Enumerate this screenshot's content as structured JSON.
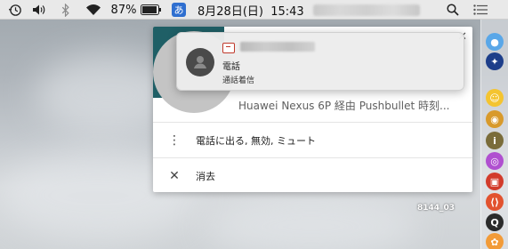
{
  "menubar": {
    "battery_percent": "87%",
    "ime_label": "あ",
    "datetime": "8月28日(日)  15:43",
    "icons": [
      "time-machine-icon",
      "volume-icon",
      "bluetooth-icon",
      "wifi-icon",
      "battery-icon",
      "search-icon",
      "list-menu-icon"
    ]
  },
  "notification": {
    "title": "電話",
    "body": "通話着信",
    "app_icon": "pushbullet-icon",
    "avatar_icon": "person-icon"
  },
  "menu_card": {
    "source": "Huawei Nexus 6P 経由 Pushbullet 時刻...",
    "actions": [
      {
        "icon": "more-vertical-icon",
        "label": "電話に出る, 無効, ミュート"
      },
      {
        "icon": "close-icon",
        "label": "消去"
      }
    ]
  },
  "desktop": {
    "file_label": "8144_03"
  },
  "colors": {
    "card_header": "#1f5f66",
    "ime_badge": "#2f6fd0",
    "menubar": "#e9e9e9"
  }
}
